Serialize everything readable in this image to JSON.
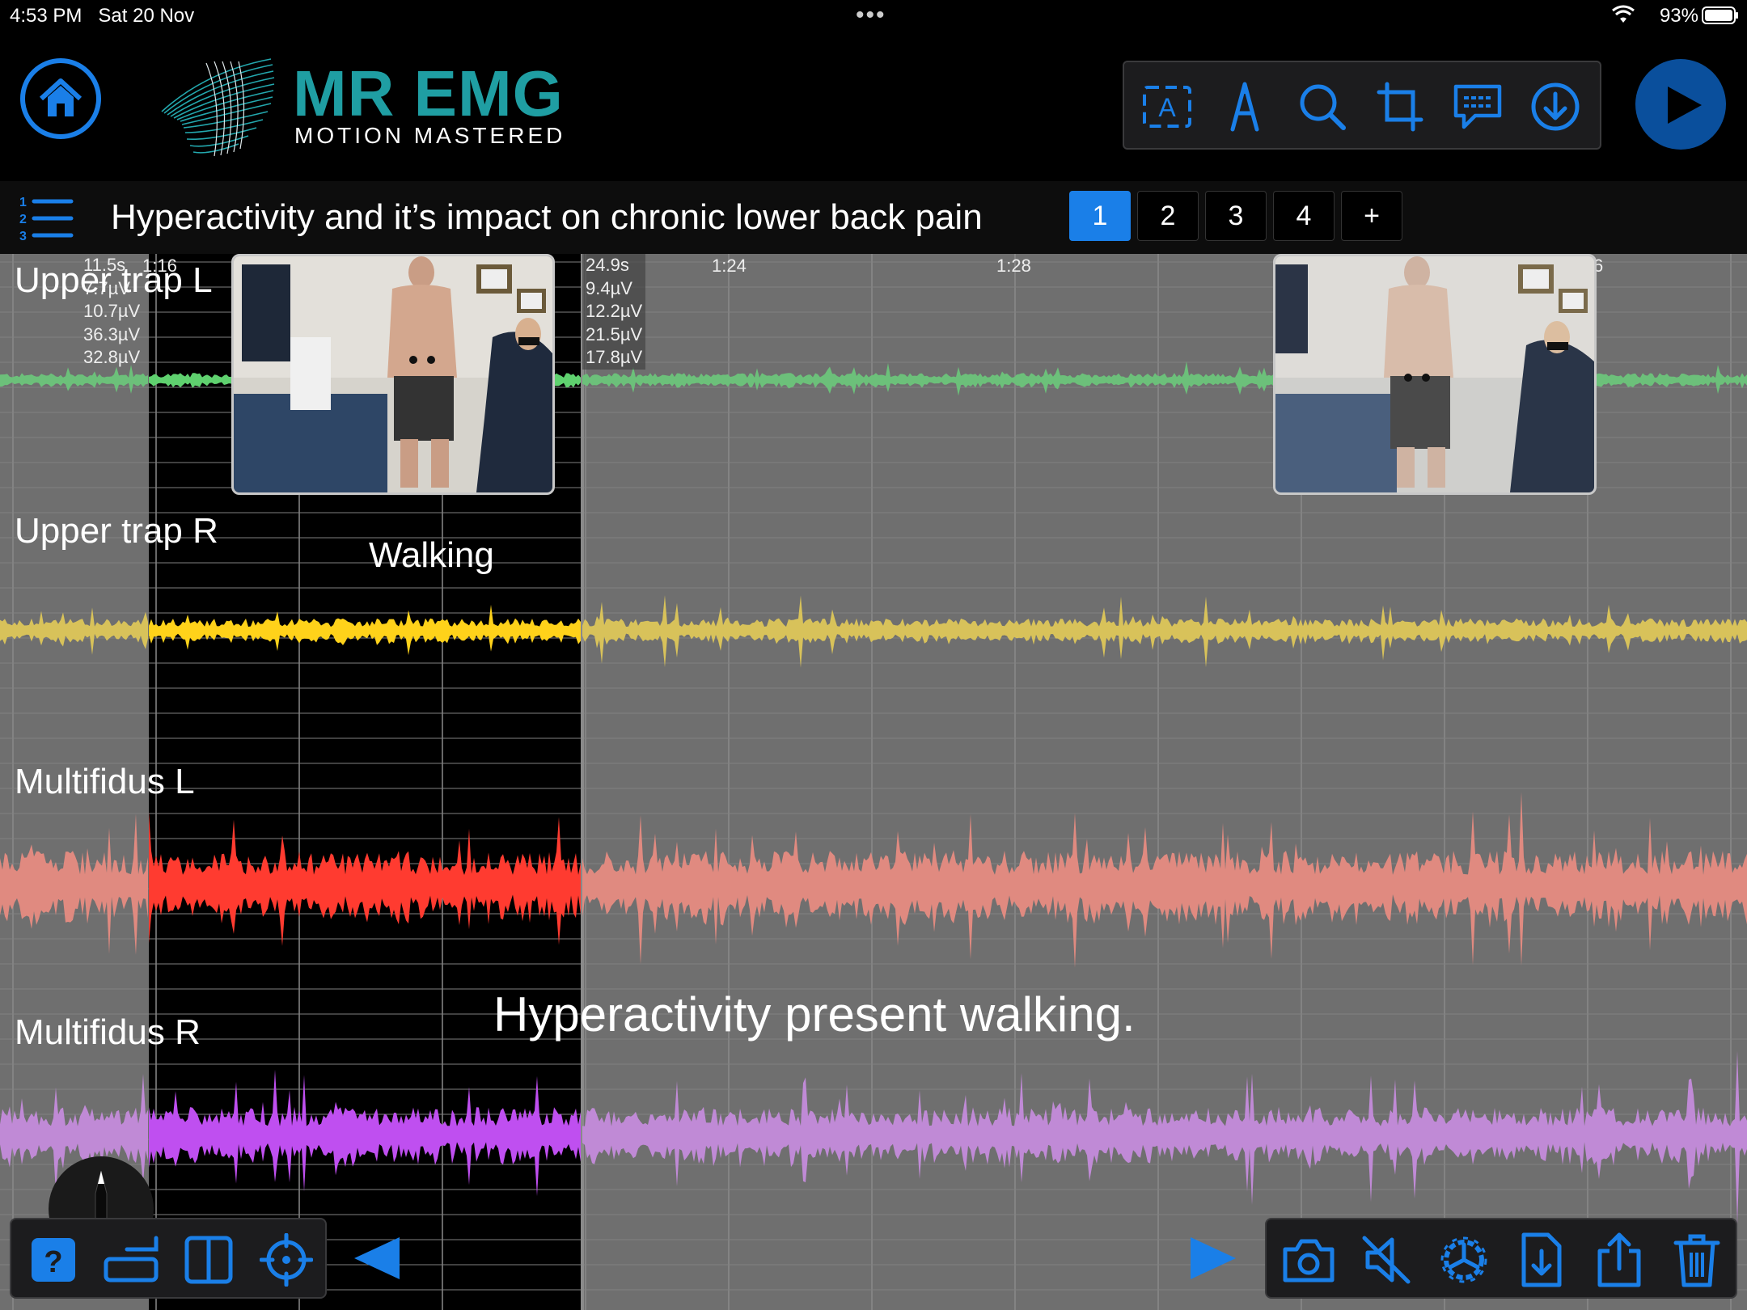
{
  "status_bar": {
    "time": "4:53 PM",
    "date": "Sat 20 Nov",
    "more": "•••",
    "battery": "93%"
  },
  "brand": {
    "name": "MR EMG",
    "tagline": "MOTION MASTERED",
    "color": "#1f9ea3"
  },
  "toolbar_top": {
    "icons": [
      "text-box-icon",
      "pen-tool-icon",
      "search-icon",
      "crop-icon",
      "comment-icon",
      "download-icon"
    ]
  },
  "report": {
    "title": "Hyperactivity and it’s impact on chronic lower back pain",
    "pages": [
      {
        "label": "1",
        "active": true
      },
      {
        "label": "2",
        "active": false
      },
      {
        "label": "3",
        "active": false
      },
      {
        "label": "4",
        "active": false
      },
      {
        "label": "+",
        "active": false
      }
    ]
  },
  "timeline": {
    "ticks": [
      "1:16",
      "1:24",
      "1:28",
      "6"
    ],
    "selection_start": {
      "time": "11.5s",
      "values": [
        "7.7µV",
        "10.7µV",
        "36.3µV",
        "32.8µV"
      ]
    },
    "selection_end": {
      "time": "24.9s",
      "values": [
        "9.4µV",
        "12.2µV",
        "21.5µV",
        "17.8µV"
      ]
    }
  },
  "channels": [
    {
      "name": "Upper trap L",
      "color": "#5fd16f",
      "dim_color": "#6cc07a"
    },
    {
      "name": "Upper trap R",
      "color": "#ffd21a",
      "dim_color": "#d8c25a"
    },
    {
      "name": "Multifidus L",
      "color": "#ff3b30",
      "dim_color": "#e08a80"
    },
    {
      "name": "Multifidus  R",
      "color": "#bf4ff0",
      "dim_color": "#c08ad6"
    }
  ],
  "annotations": {
    "segment_label": "Walking",
    "note": "Hyperactivity present walking."
  },
  "pencil": {
    "value": "97"
  },
  "colors": {
    "accent": "#1a7fe8",
    "chart_bg": "#6f6f6f",
    "selection_bg": "#000000"
  }
}
